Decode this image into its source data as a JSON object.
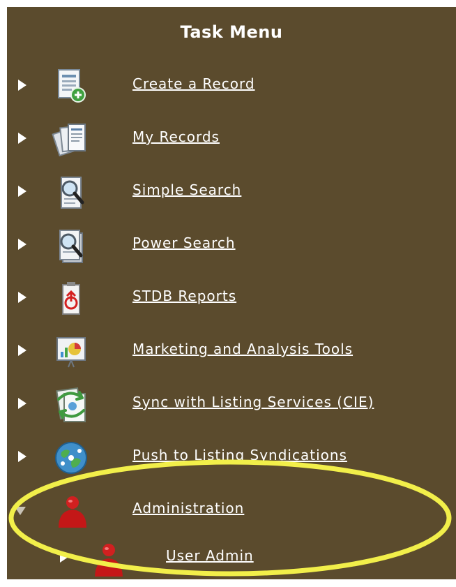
{
  "panel": {
    "title": "Task Menu",
    "items": [
      {
        "label": "Create a Record",
        "icon": "create-record-icon"
      },
      {
        "label": "My Records",
        "icon": "my-records-icon"
      },
      {
        "label": "Simple Search",
        "icon": "simple-search-icon"
      },
      {
        "label": "Power Search",
        "icon": "power-search-icon"
      },
      {
        "label": "STDB Reports",
        "icon": "stdb-reports-icon"
      },
      {
        "label": "Marketing and Analysis Tools",
        "icon": "marketing-tools-icon"
      },
      {
        "label": "Sync with Listing Services (CIE)",
        "icon": "sync-icon"
      },
      {
        "label": "Push to Listing Syndications",
        "icon": "globe-icon"
      },
      {
        "label": "Administration",
        "icon": "admin-icon"
      }
    ],
    "subitems": [
      {
        "label": "User Admin",
        "icon": "user-admin-icon"
      }
    ]
  },
  "colors": {
    "panel_background": "#5b4b2d",
    "text": "#ffffff",
    "highlight_ring": "#f2ef4a",
    "admin_icon": "#cc1f1f"
  }
}
